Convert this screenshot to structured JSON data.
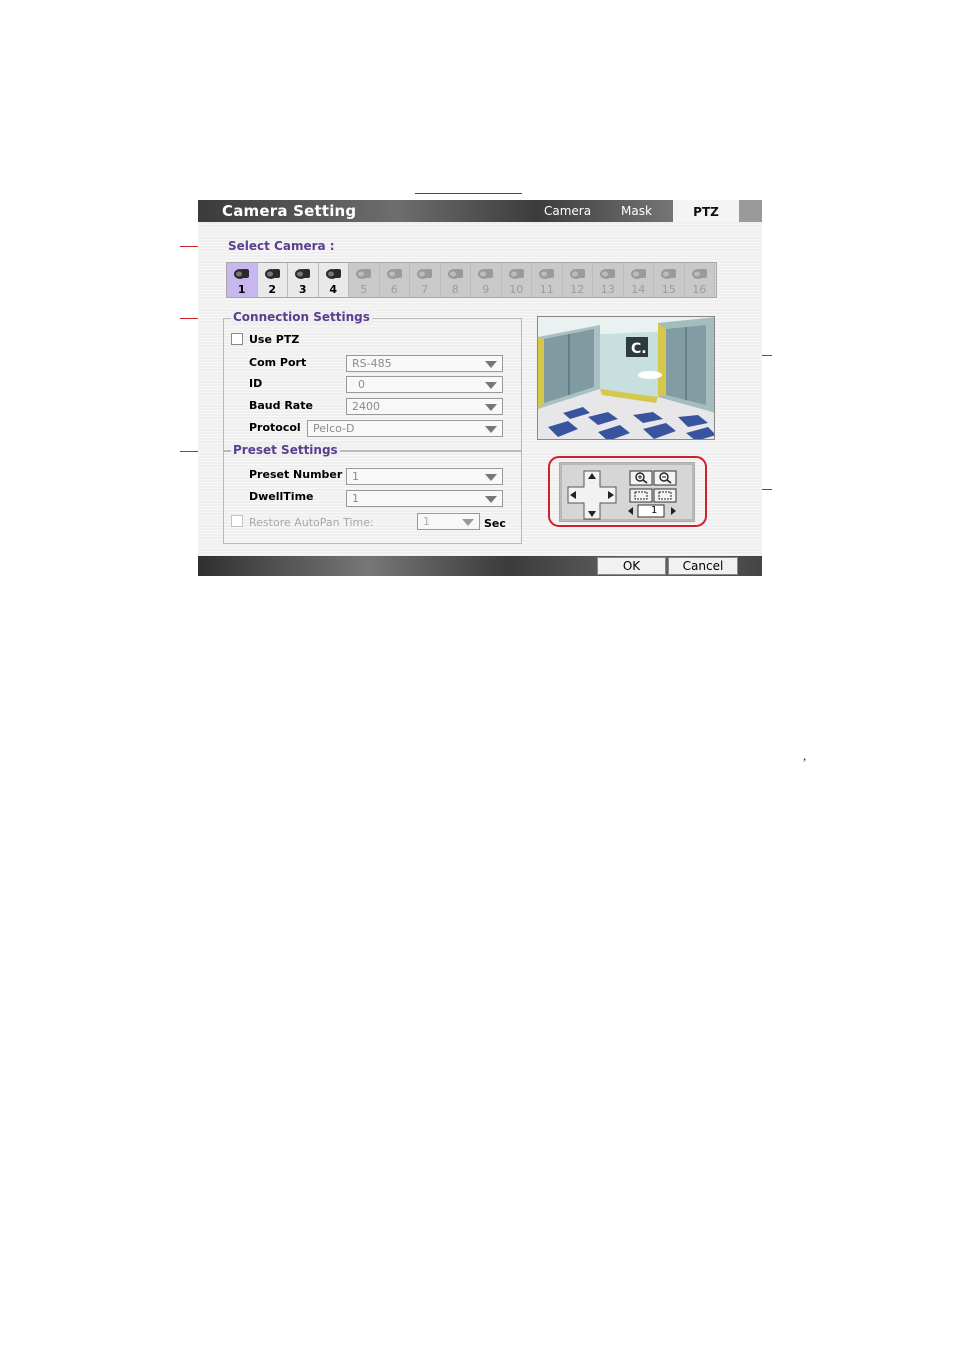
{
  "window": {
    "title": "Camera Setting",
    "tabs": [
      "Camera",
      "Mask",
      "PTZ"
    ],
    "active_tab": "PTZ"
  },
  "select_camera": {
    "label": "Select Camera :",
    "cameras": [
      "1",
      "2",
      "3",
      "4",
      "5",
      "6",
      "7",
      "8",
      "9",
      "10",
      "11",
      "12",
      "13",
      "14",
      "15",
      "16"
    ],
    "enabled_count": 4,
    "selected": "1"
  },
  "connection": {
    "legend": "Connection Settings",
    "use_ptz_label": "Use PTZ",
    "use_ptz_checked": false,
    "com_port_label": "Com Port",
    "com_port_value": "RS-485",
    "id_label": "ID",
    "id_value": "0",
    "baud_rate_label": "Baud Rate",
    "baud_rate_value": "2400",
    "protocol_label": "Protocol",
    "protocol_value": "Pelco-D"
  },
  "preset": {
    "legend": "Preset Settings",
    "preset_number_label": "Preset Number",
    "preset_number_value": "1",
    "dwell_time_label": "DwellTime",
    "dwell_time_value": "1",
    "restore_label": "Restore AutoPan Time:",
    "restore_value": "1",
    "restore_unit": "Sec"
  },
  "ptz_control": {
    "preset_index": "1"
  },
  "preview": {
    "sign_text": "C."
  },
  "buttons": {
    "ok": "OK",
    "cancel": "Cancel"
  },
  "colors": {
    "callout": "#d0202c",
    "section_label": "#5c3d8f",
    "selected_camera": "#c8b6ef"
  }
}
